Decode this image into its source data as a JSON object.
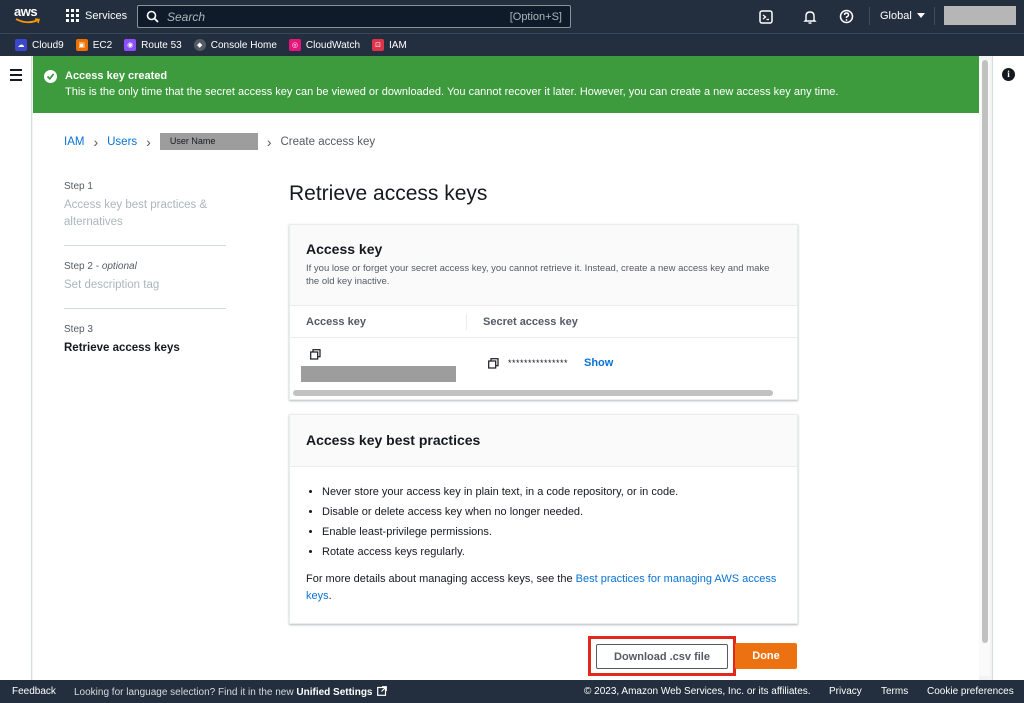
{
  "topnav": {
    "logo_text": "aws",
    "services_label": "Services",
    "search_placeholder": "Search",
    "search_shortcut": "[Option+S]",
    "region_label": "Global"
  },
  "favorites": [
    {
      "label": "Cloud9",
      "color": "#3b48cc"
    },
    {
      "label": "EC2",
      "color": "#ed7100"
    },
    {
      "label": "Route 53",
      "color": "#8c4fff"
    },
    {
      "label": "Console Home",
      "color": "#545b64"
    },
    {
      "label": "CloudWatch",
      "color": "#e7157b"
    },
    {
      "label": "IAM",
      "color": "#dd344c"
    }
  ],
  "flash": {
    "title": "Access key created",
    "message": "This is the only time that the secret access key can be viewed or downloaded. You cannot recover it later. However, you can create a new access key any time."
  },
  "breadcrumb": {
    "iam": "IAM",
    "users": "Users",
    "user_name": "User Name",
    "current": "Create access key"
  },
  "steps": [
    {
      "num": "Step 1",
      "optional": "",
      "name": "Access key best practices & alternatives"
    },
    {
      "num": "Step 2 - ",
      "optional": "optional",
      "name": "Set description tag"
    },
    {
      "num": "Step 3",
      "optional": "",
      "name": "Retrieve access keys"
    }
  ],
  "page_title": "Retrieve access keys",
  "access_key_card": {
    "title": "Access key",
    "description": "If you lose or forget your secret access key, you cannot retrieve it. Instead, create a new access key and make the old key inactive.",
    "col_access_key": "Access key",
    "col_secret": "Secret access key",
    "secret_masked": "***************",
    "show_label": "Show"
  },
  "best_practices_card": {
    "title": "Access key best practices",
    "items": [
      "Never store your access key in plain text, in a code repository, or in code.",
      "Disable or delete access key when no longer needed.",
      "Enable least-privilege permissions.",
      "Rotate access keys regularly."
    ],
    "more_prefix": "For more details about managing access keys, see the ",
    "more_link": "Best practices for managing AWS access keys",
    "more_suffix": "."
  },
  "actions": {
    "download_label": "Download .csv file",
    "done_label": "Done"
  },
  "footer": {
    "feedback": "Feedback",
    "language_prefix": "Looking for language selection? Find it in the new ",
    "unified_settings": "Unified Settings",
    "copyright": "© 2023, Amazon Web Services, Inc. or its affiliates.",
    "privacy": "Privacy",
    "terms": "Terms",
    "cookies": "Cookie preferences"
  },
  "colors": {
    "nav_bg": "#232f3e",
    "success": "#3d9a3d",
    "link": "#0972d3",
    "primary_button": "#ec7211",
    "highlight": "#e0291b"
  }
}
